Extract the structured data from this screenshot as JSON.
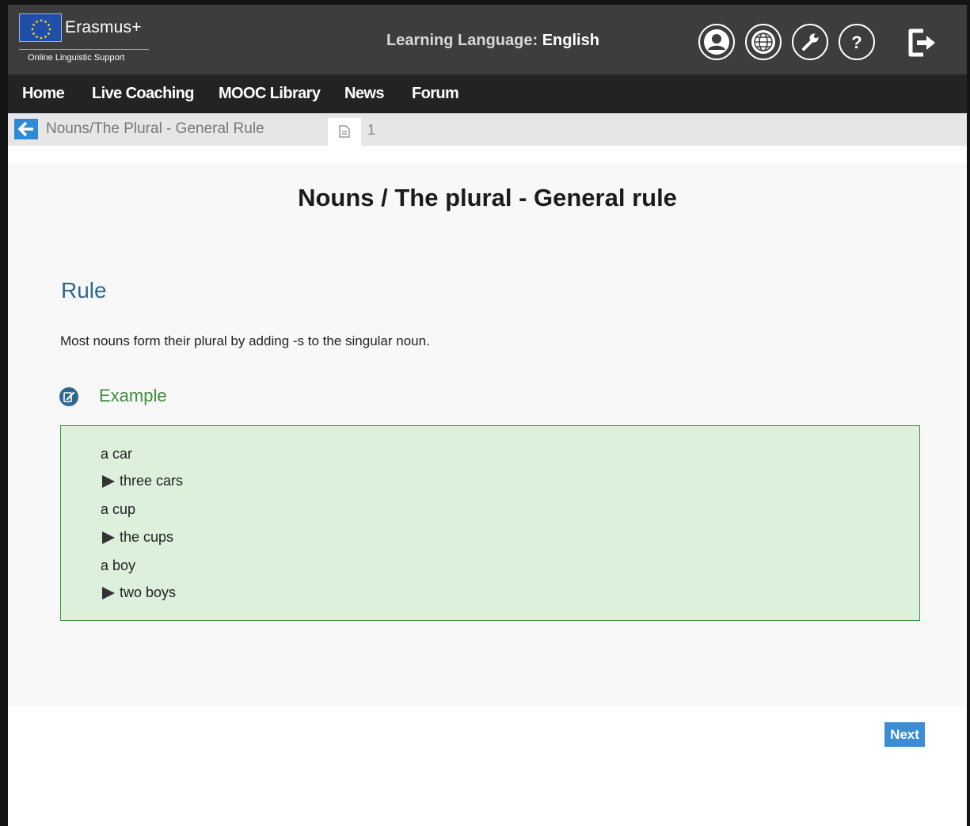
{
  "header": {
    "logo": {
      "name": "Erasmus+",
      "subtitle": "Online Linguistic Support",
      "flag_icon": "eu-flag-icon"
    },
    "learning_label": "Learning Language:",
    "learning_value": "English",
    "icons": [
      "user-icon",
      "globe-icon",
      "wrench-icon",
      "help-icon",
      "logout-icon"
    ]
  },
  "nav": {
    "items": [
      {
        "label": "Home"
      },
      {
        "label": "Live Coaching"
      },
      {
        "label": "MOOC Library"
      },
      {
        "label": "News"
      },
      {
        "label": "Forum"
      }
    ]
  },
  "breadcrumb": {
    "back_icon": "arrow-left-icon",
    "text": "Nouns/The Plural - General Rule",
    "page_icon": "document-icon",
    "page_number": "1"
  },
  "content": {
    "title": "Nouns / The plural - General rule",
    "rule_heading": "Rule",
    "rule_text": "Most nouns form their plural by adding -s to the singular noun.",
    "example_icon": "edit-note-icon",
    "example_label": "Example",
    "examples": [
      {
        "singular": "a car",
        "plural": "three cars"
      },
      {
        "singular": "a cup",
        "plural": "the cups"
      },
      {
        "singular": "a boy",
        "plural": "two boys"
      }
    ]
  },
  "footer": {
    "next_label": "Next"
  },
  "colors": {
    "header_bg": "#3d3d3d",
    "nav_bg": "#232323",
    "accent_blue": "#3c8dd6",
    "heading_blue": "#2e6790",
    "example_green": "#3f8b3d",
    "example_bg": "#dcf0dc"
  }
}
